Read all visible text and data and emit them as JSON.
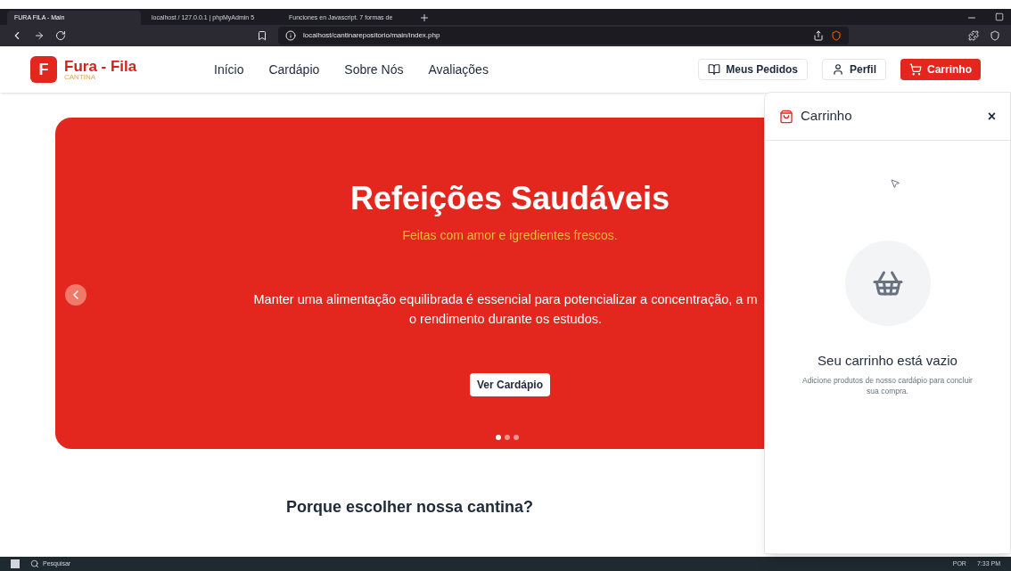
{
  "browser": {
    "tabs": [
      {
        "title": "FURA FILA - Main",
        "selected": true
      },
      {
        "title": "localhost / 127.0.0.1 | phpMyAdmin 5",
        "selected": false
      },
      {
        "title": "Funciones en Javascript. 7 formas de",
        "selected": false
      }
    ],
    "address": "localhost/cantinarepositorio/main/index.php"
  },
  "header": {
    "logo_letter": "F",
    "brand": "Fura - Fila",
    "tagline": "CANTINA",
    "nav": [
      "Início",
      "Cardápio",
      "Sobre Nós",
      "Avaliações"
    ],
    "actions": [
      {
        "label": "Meus Pedidos",
        "kind": "orders"
      },
      {
        "label": "Perfil",
        "kind": "profile"
      },
      {
        "label": "Carrinho",
        "kind": "cart"
      }
    ]
  },
  "hero": {
    "title": "Refeições Saudáveis",
    "subtitle": "Feitas com amor e igredientes frescos.",
    "body": [
      "Manter uma alimentação equilibrada é essencial para potencializar a concentração, a m",
      "o rendimento durante os estudos."
    ],
    "button": "Ver Cardápio",
    "dots": [
      {
        "selected": true
      },
      {
        "selected": false
      },
      {
        "selected": false
      }
    ]
  },
  "section_title": "Porque escolher nossa cantina?",
  "cart_panel": {
    "title": "Carrinho",
    "close": "×",
    "empty_title": "Seu carrinho está vazio",
    "empty_text": "Adicione produtos de nosso cardápio para concluir sua compra."
  },
  "taskbar": {
    "search": "Pesquisar",
    "language": "POR",
    "time": "7:33 PM"
  }
}
